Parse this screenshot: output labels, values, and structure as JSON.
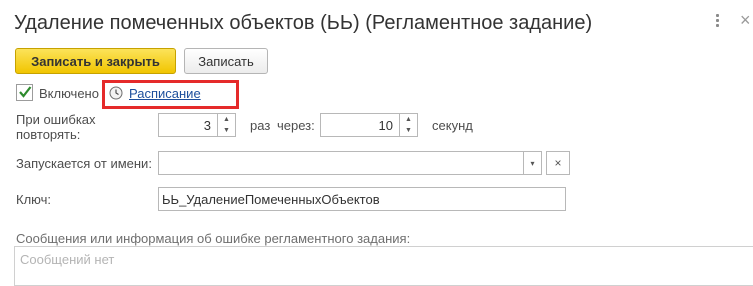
{
  "window": {
    "title": "Удаление помеченных объектов (ЬЬ) (Регламентное задание)",
    "menu_icon": "more-vertical-icon",
    "close_icon": "close-icon",
    "close_glyph": "×"
  },
  "toolbar": {
    "save_close_label": "Записать и закрыть",
    "save_label": "Записать"
  },
  "enabled": {
    "label": "Включено",
    "checked": true
  },
  "schedule": {
    "link_text": "Расписание",
    "icon": "clock-icon"
  },
  "retry": {
    "label_line1": "При ошибках",
    "label_line2": "повторять:",
    "count_value": "3",
    "times_label": "раз",
    "through_label": "через:",
    "interval_value": "10",
    "seconds_label": "секунд"
  },
  "run_as": {
    "label": "Запускается от имени:",
    "value": "",
    "dropdown_glyph": "▾",
    "clear_glyph": "×"
  },
  "key": {
    "label": "Ключ:",
    "value": "ЬЬ_УдалениеПомеченныхОбъектов"
  },
  "messages": {
    "label": "Сообщения или информация об ошибке регламентного задания:",
    "placeholder": "Сообщений нет"
  },
  "colors": {
    "primary_button": "#f5cd1a",
    "highlight_box": "#e52a2a",
    "link": "#1c4e9c"
  }
}
